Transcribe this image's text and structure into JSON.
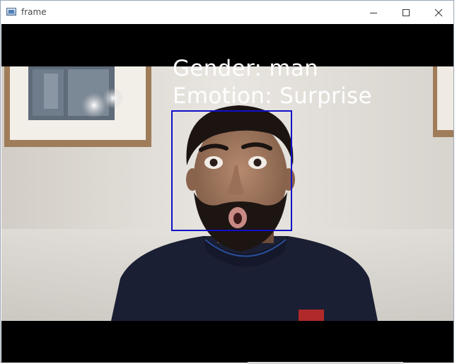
{
  "window": {
    "title": "frame",
    "icon": "window-app-icon",
    "controls": [
      "minimize-icon",
      "maximize-icon",
      "close-icon"
    ]
  },
  "overlay": {
    "gender_text": "Gender: man",
    "emotion_text": "Emotion: Surprise"
  },
  "colors": {
    "face_box": "#1010c8",
    "overlay_text": "#ffffff",
    "letterbox": "#000000"
  }
}
